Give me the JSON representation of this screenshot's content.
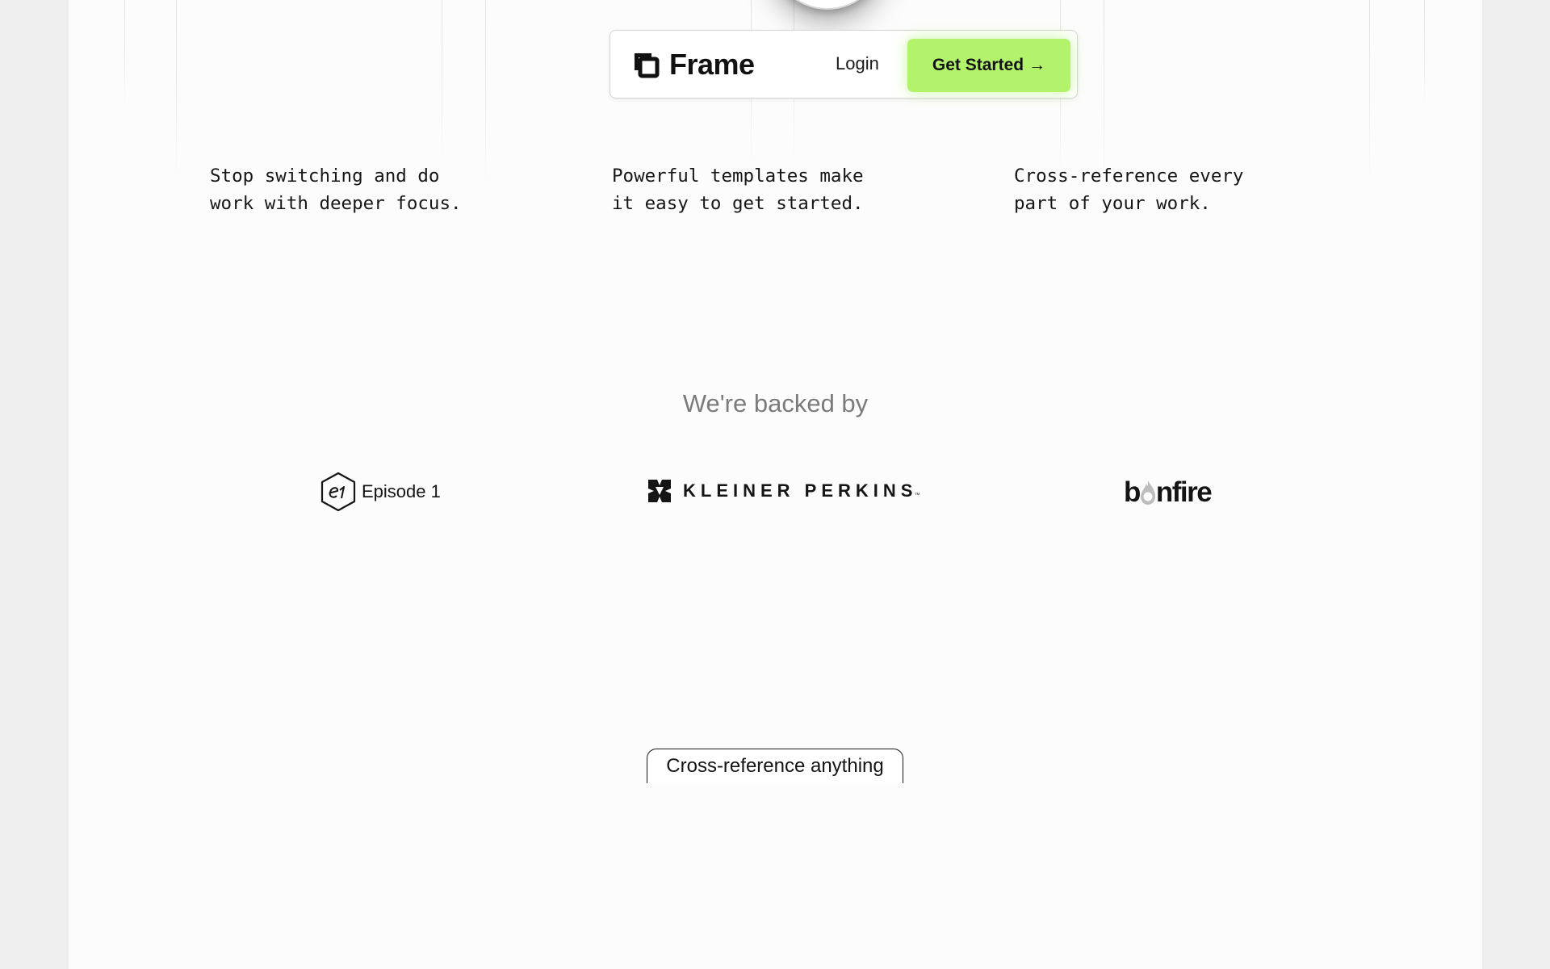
{
  "nav": {
    "brand_name": "Frame",
    "login_label": "Login",
    "cta_label": "Get Started",
    "cta_arrow": "→"
  },
  "features": [
    {
      "text": "Stop switching and do\nwork with deeper focus."
    },
    {
      "text": "Powerful templates make\nit easy to get started."
    },
    {
      "text": "Cross-reference every\npart of your work."
    }
  ],
  "backers": {
    "title": "We're backed by",
    "logos": [
      {
        "name": "Episode 1",
        "icon": "e1-hexagon-icon"
      },
      {
        "name": "KLEINER PERKINS",
        "suffix": "™",
        "icon": "kleiner-perkins-mark-icon"
      },
      {
        "name_pre": "b",
        "name_post": "nfire",
        "icon": "bonfire-flame-icon"
      }
    ]
  },
  "section_pill": {
    "label": "Cross-reference anything"
  },
  "colors": {
    "accent": "#b3f36c",
    "page_bg": "#fcfcfc",
    "outer_bg": "#efefef",
    "muted_text": "#7b7b7b"
  }
}
